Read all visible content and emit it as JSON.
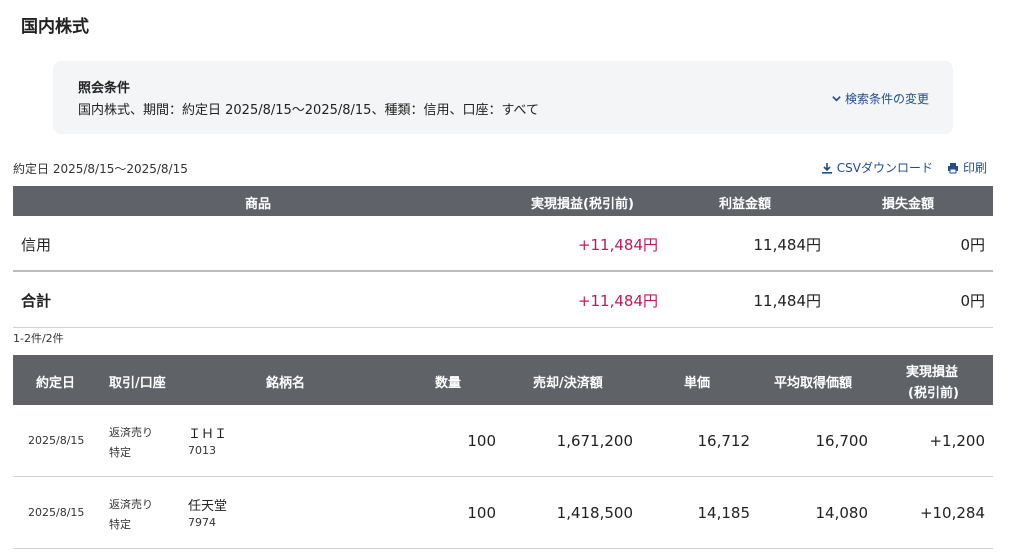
{
  "page": {
    "title": "国内株式"
  },
  "conditions": {
    "label": "照会条件",
    "text": "国内株式、期間：約定日 2025/8/15～2025/8/15、種類：信用、口座：すべて",
    "change_label": "検索条件の変更"
  },
  "period_label": "約定日 2025/8/15～2025/8/15",
  "tools": {
    "csv_label": "CSVダウンロード",
    "print_label": "印刷"
  },
  "summary": {
    "headers": {
      "product": "商品",
      "realized": "実現損益(税引前)",
      "profit": "利益金額",
      "loss": "損失金額"
    },
    "rows": [
      {
        "product": "信用",
        "realized": "+11,484円",
        "profit": "11,484円",
        "loss": "0円"
      }
    ],
    "total": {
      "label": "合計",
      "realized": "+11,484円",
      "profit": "11,484円",
      "loss": "0円"
    }
  },
  "count_label": "1-2件/2件",
  "detail": {
    "headers": {
      "date": "約定日",
      "trade": "取引/口座",
      "stock": "銘柄名",
      "qty": "数量",
      "amount": "売却/決済額",
      "unit": "単価",
      "avg": "平均取得価額",
      "pl_line1": "実現損益",
      "pl_line2": "(税引前)"
    },
    "rows": [
      {
        "date": "2025/8/15",
        "trade": "返済売り",
        "account": "特定",
        "stock": "ＩＨＩ",
        "code": "7013",
        "qty": "100",
        "amount": "1,671,200",
        "unit": "16,712",
        "avg": "16,700",
        "pl": "+1,200"
      },
      {
        "date": "2025/8/15",
        "trade": "返済売り",
        "account": "特定",
        "stock": "任天堂",
        "code": "7974",
        "qty": "100",
        "amount": "1,418,500",
        "unit": "14,185",
        "avg": "14,080",
        "pl": "+10,284"
      }
    ]
  },
  "colors": {
    "header_bg": "#5f6368",
    "positive": "#c3185a",
    "link": "#1f4e8c",
    "panel_bg": "#f4f5f6"
  }
}
